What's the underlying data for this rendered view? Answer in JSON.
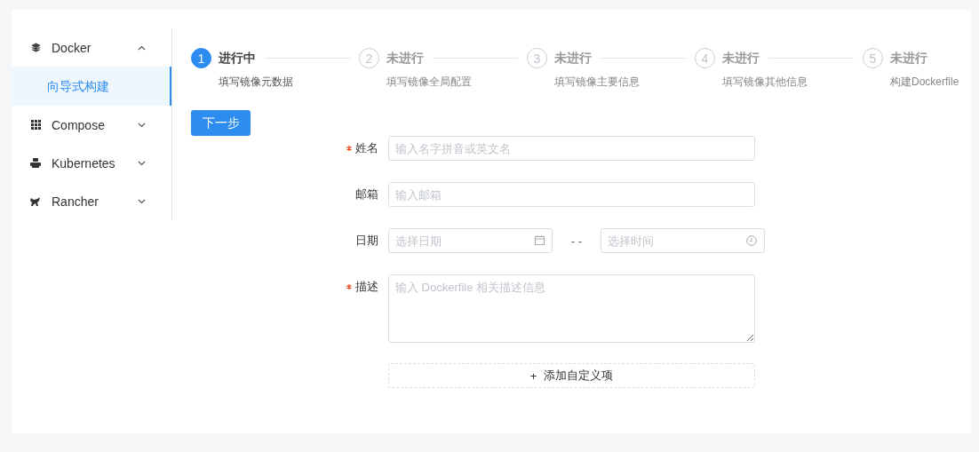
{
  "sidebar": {
    "items": [
      {
        "label": "Docker",
        "expanded": true,
        "children": [
          {
            "label": "向导式构建",
            "selected": true
          }
        ]
      },
      {
        "label": "Compose",
        "expanded": false
      },
      {
        "label": "Kubernetes",
        "expanded": false
      },
      {
        "label": "Rancher",
        "expanded": false
      }
    ]
  },
  "steps": [
    {
      "number": "1",
      "title": "进行中",
      "description": "填写镜像元数据",
      "current": true
    },
    {
      "number": "2",
      "title": "未进行",
      "description": "填写镜像全局配置",
      "current": false
    },
    {
      "number": "3",
      "title": "未进行",
      "description": "填写镜像主要信息",
      "current": false
    },
    {
      "number": "4",
      "title": "未进行",
      "description": "填写镜像其他信息",
      "current": false
    },
    {
      "number": "5",
      "title": "未进行",
      "description": "构建Dockerfile",
      "current": false
    }
  ],
  "next_button": "下一步",
  "form": {
    "fields": [
      {
        "kind": "text",
        "label": "姓名",
        "required": true,
        "placeholder": "输入名字拼音或英文名"
      },
      {
        "kind": "text",
        "label": "邮箱",
        "required": false,
        "placeholder": "输入邮箱"
      },
      {
        "kind": "datetime",
        "label": "日期",
        "required": false,
        "date_placeholder": "选择日期",
        "separator": "- -",
        "time_placeholder": "选择时间"
      },
      {
        "kind": "textarea",
        "label": "描述",
        "required": true,
        "placeholder": "输入 Dockerfile 相关描述信息"
      }
    ],
    "add_button": {
      "icon": "+",
      "label": "添加自定义项"
    }
  }
}
